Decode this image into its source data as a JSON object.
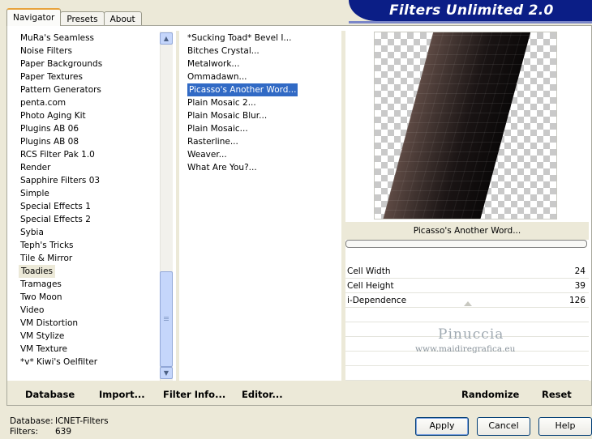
{
  "tabs": [
    "Navigator",
    "Presets",
    "About"
  ],
  "banner": {
    "title": "Filters Unlimited 2.0"
  },
  "categories": [
    "MuRa's Seamless",
    "Noise Filters",
    "Paper Backgrounds",
    "Paper Textures",
    "Pattern Generators",
    "penta.com",
    "Photo Aging Kit",
    "Plugins AB 06",
    "Plugins AB 08",
    "RCS Filter Pak 1.0",
    "Render",
    "Sapphire Filters 03",
    "Simple",
    "Special Effects 1",
    "Special Effects 2",
    "Sybia",
    "Teph's Tricks",
    "Tile & Mirror",
    "Toadies",
    "Tramages",
    "Two Moon",
    "Video",
    "VM Distortion",
    "VM Stylize",
    "VM Texture",
    "*v* Kiwi's Oelfilter"
  ],
  "selected_category": "Toadies",
  "filters": [
    "*Sucking Toad* Bevel I...",
    "Bitches Crystal...",
    "Metalwork...",
    "Ommadawn...",
    "Picasso's Another Word...",
    "Plain Mosaic 2...",
    "Plain Mosaic Blur...",
    "Plain Mosaic...",
    "Rasterline...",
    "Weaver...",
    "What Are You?..."
  ],
  "selected_filter": "Picasso's Another Word...",
  "preview_caption": "Picasso's Another Word...",
  "params": [
    {
      "label": "Cell Width",
      "value": "24"
    },
    {
      "label": "Cell Height",
      "value": "39"
    },
    {
      "label": "i-Dependence",
      "value": "126"
    }
  ],
  "watermark": {
    "name": "Pinuccia",
    "url": "www.maidiregrafica.eu"
  },
  "toolbar": {
    "database": "Database",
    "import": "Import...",
    "filter_info": "Filter Info...",
    "editor": "Editor...",
    "randomize": "Randomize",
    "reset": "Reset"
  },
  "status": {
    "database_label": "Database:",
    "database_value": "ICNET-Filters",
    "filters_label": "Filters:",
    "filters_value": "639"
  },
  "buttons": {
    "apply": "Apply",
    "cancel": "Cancel",
    "help": "Help"
  }
}
